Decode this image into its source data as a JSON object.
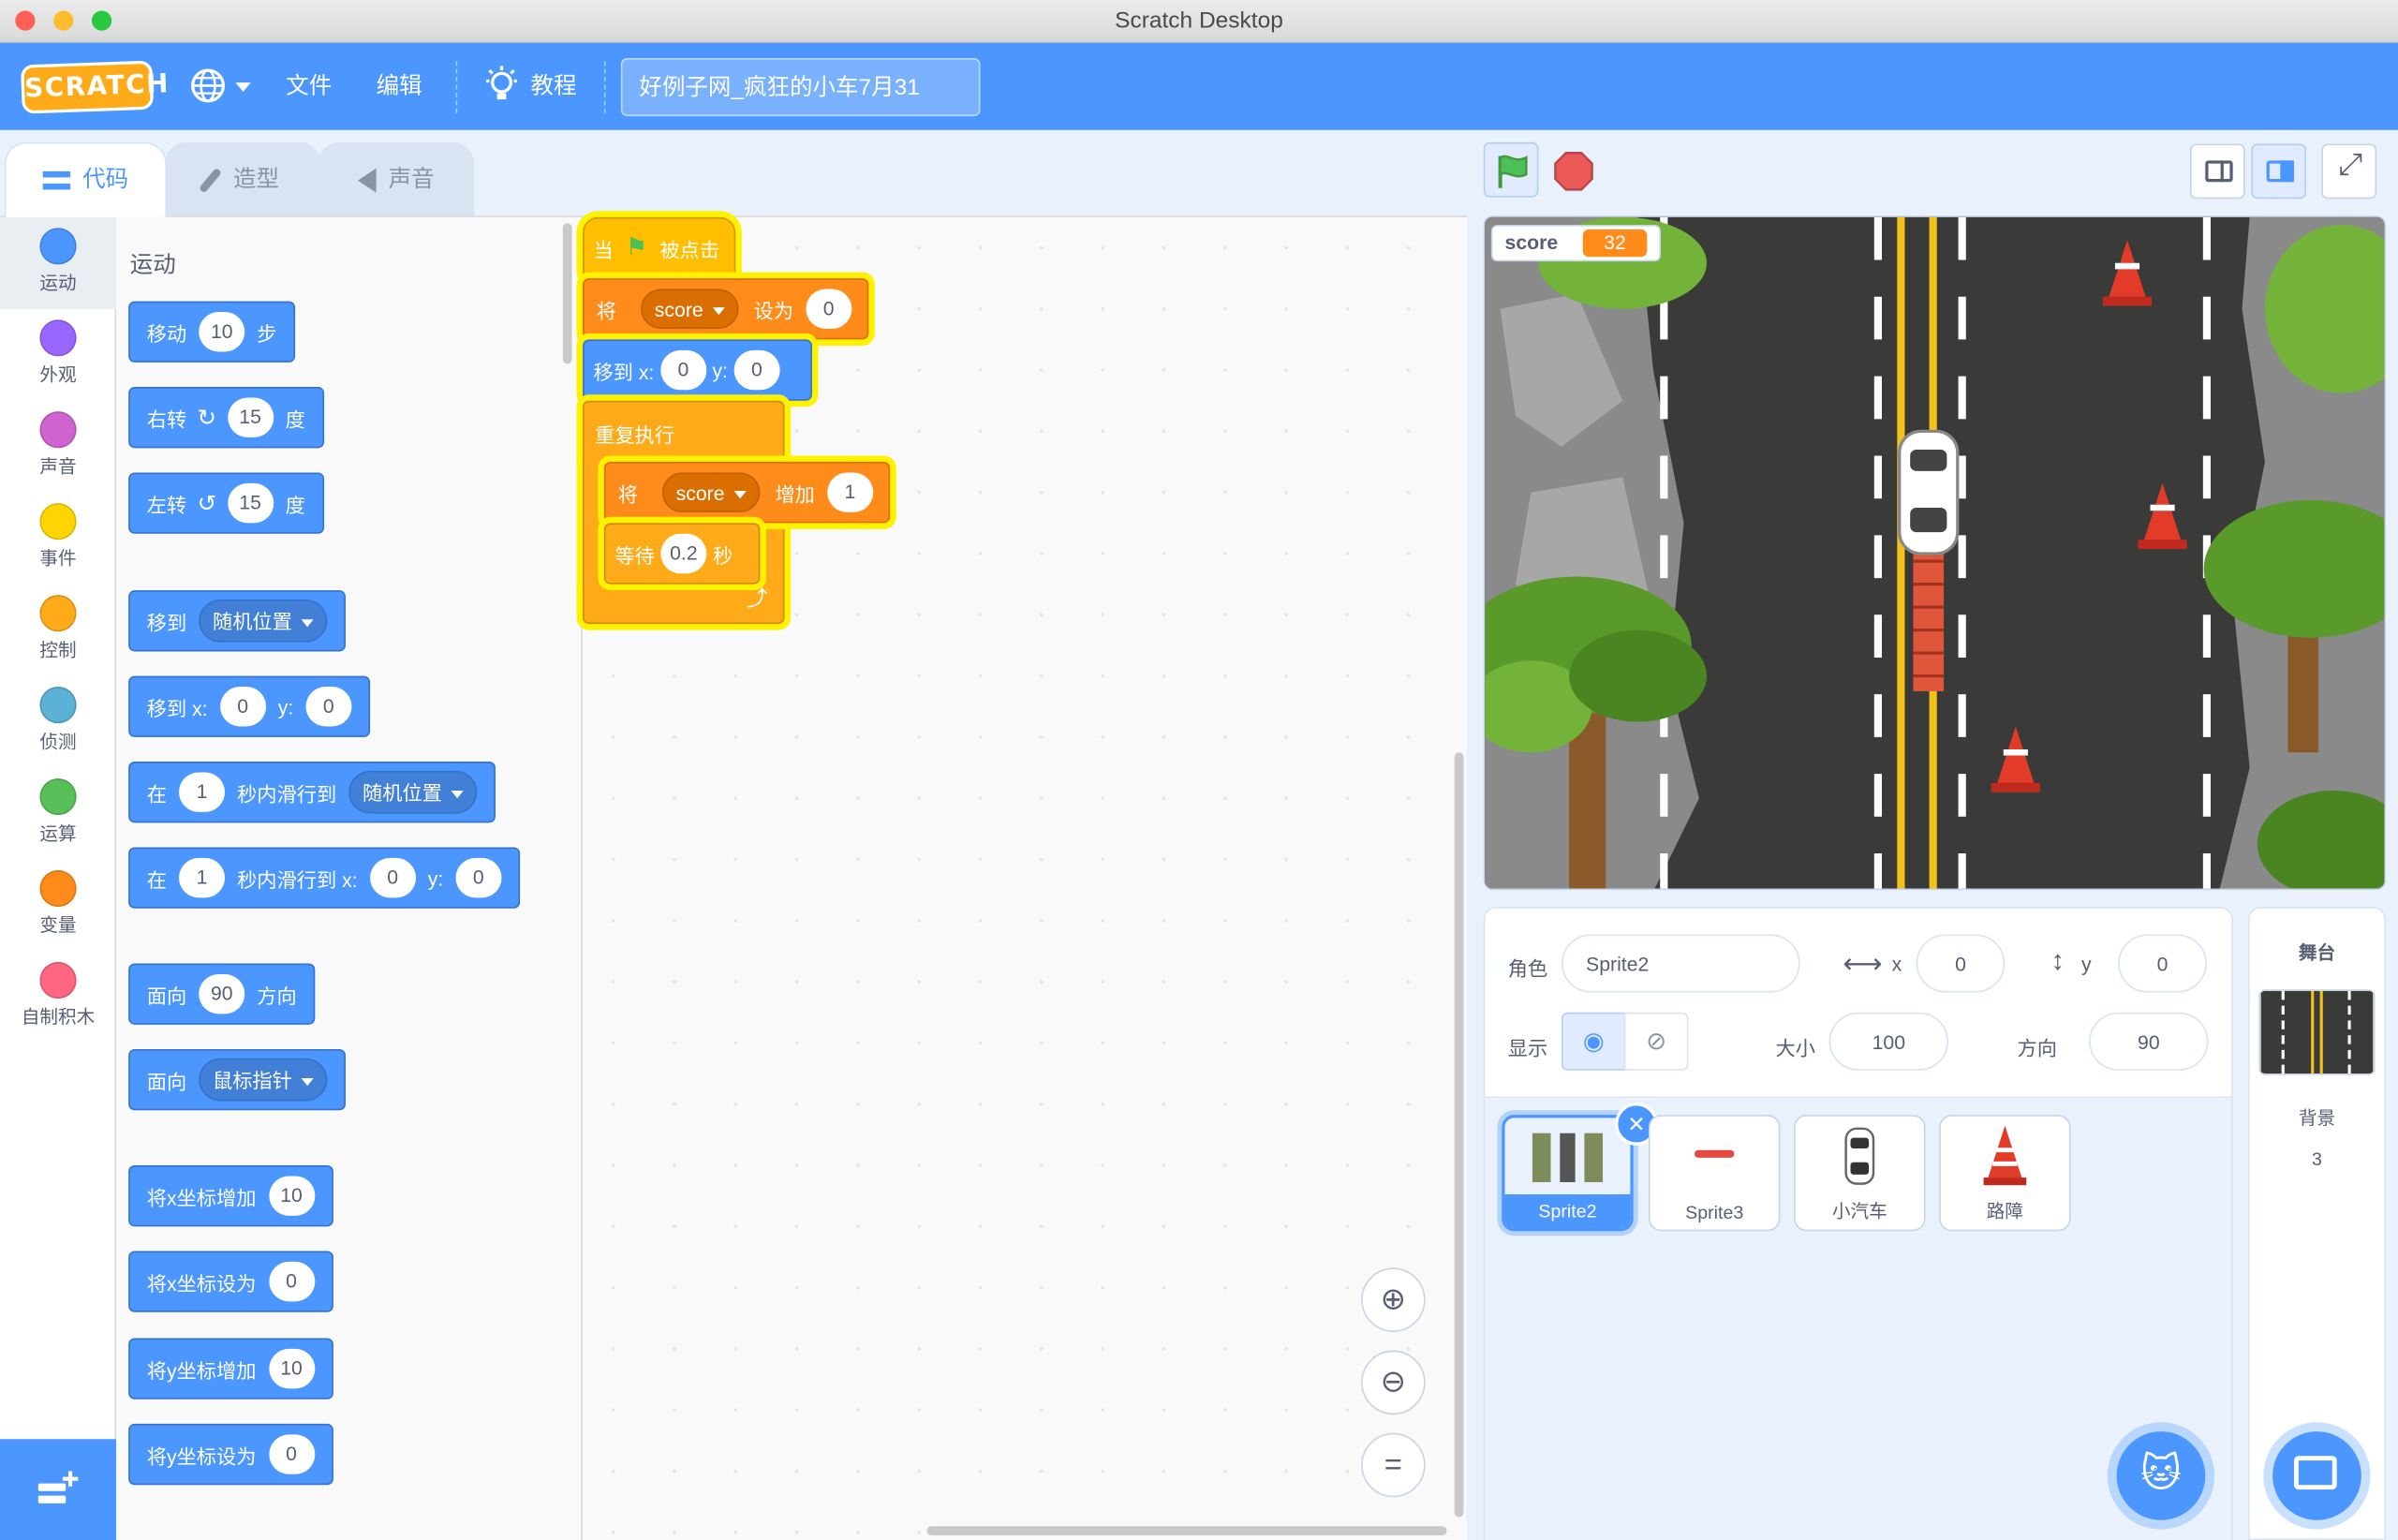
{
  "window": {
    "title": "Scratch Desktop"
  },
  "menu": {
    "logo": "SCRATCH",
    "file": "文件",
    "edit": "编辑",
    "tutorials": "教程",
    "project_title": "好例子网_疯狂的小车7月31"
  },
  "tabs": {
    "code": "代码",
    "costumes": "造型",
    "sounds": "声音"
  },
  "categories": [
    {
      "label": "运动",
      "color": "#4c97ff"
    },
    {
      "label": "外观",
      "color": "#9966ff"
    },
    {
      "label": "声音",
      "color": "#cf63cf"
    },
    {
      "label": "事件",
      "color": "#ffd500"
    },
    {
      "label": "控制",
      "color": "#ffab19"
    },
    {
      "label": "侦测",
      "color": "#5cb1d6"
    },
    {
      "label": "运算",
      "color": "#59c059"
    },
    {
      "label": "变量",
      "color": "#ff8c1a"
    },
    {
      "label": "自制积木",
      "color": "#ff6680"
    }
  ],
  "palette": {
    "section": "运动",
    "move": {
      "a": "移动",
      "n": "10",
      "b": "步"
    },
    "turn_right": {
      "a": "右转",
      "n": "15",
      "b": "度"
    },
    "turn_left": {
      "a": "左转",
      "n": "15",
      "b": "度"
    },
    "goto": {
      "a": "移到",
      "dd": "随机位置"
    },
    "goto_xy": {
      "a": "移到 x:",
      "x": "0",
      "b": "y:",
      "y": "0"
    },
    "glide": {
      "a": "在",
      "n": "1",
      "b": "秒内滑行到",
      "dd": "随机位置"
    },
    "glide_xy": {
      "a": "在",
      "n": "1",
      "b": "秒内滑行到 x:",
      "x": "0",
      "c": "y:",
      "y": "0"
    },
    "point_dir": {
      "a": "面向",
      "n": "90",
      "b": "方向"
    },
    "point_towards": {
      "a": "面向",
      "dd": "鼠标指针"
    },
    "change_x": {
      "a": "将x坐标增加",
      "n": "10"
    },
    "set_x": {
      "a": "将x坐标设为",
      "n": "0"
    },
    "change_y": {
      "a": "将y坐标增加",
      "n": "10"
    },
    "set_y": {
      "a": "将y坐标设为",
      "n": "0"
    }
  },
  "script": {
    "hat_a": "当",
    "hat_b": "被点击",
    "set_a": "将",
    "set_var": "score",
    "set_b": "设为",
    "set_val": "0",
    "goto_a": "移到 x:",
    "goto_x": "0",
    "goto_b": "y:",
    "goto_y": "0",
    "forever": "重复执行",
    "change_a": "将",
    "change_var": "score",
    "change_b": "增加",
    "change_val": "1",
    "wait_a": "等待",
    "wait_val": "0.2",
    "wait_b": "秒"
  },
  "stage": {
    "monitor_label": "score",
    "monitor_value": "32"
  },
  "sprite_info": {
    "sprite_label": "角色",
    "sprite_name": "Sprite2",
    "x_label": "x",
    "x": "0",
    "y_label": "y",
    "y": "0",
    "show_label": "显示",
    "size_label": "大小",
    "size": "100",
    "dir_label": "方向",
    "direction": "90"
  },
  "sprites": [
    {
      "name": "Sprite2"
    },
    {
      "name": "Sprite3"
    },
    {
      "name": "小汽车"
    },
    {
      "name": "路障"
    }
  ],
  "stage_pane": {
    "title": "舞台",
    "backdrops_label": "背景",
    "backdrops_count": "3"
  }
}
